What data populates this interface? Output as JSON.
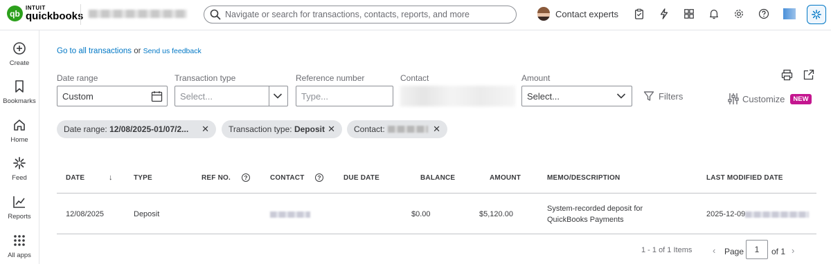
{
  "brand": {
    "intuit": "INTUIT",
    "name": "quickbooks",
    "mark": "qb",
    "color": "#2ca01c"
  },
  "search": {
    "placeholder": "Navigate or search for transactions, contacts, reports, and more"
  },
  "header": {
    "contact_experts": "Contact experts",
    "icons": [
      "clipboard-icon",
      "lightning-icon",
      "apps-grid-icon",
      "bell-icon",
      "gear-icon",
      "help-icon",
      "app-square-icon",
      "sparkle-icon"
    ]
  },
  "sidebar": {
    "items": [
      {
        "label": "Create",
        "icon": "plus-circle-icon"
      },
      {
        "label": "Bookmarks",
        "icon": "bookmark-icon"
      },
      {
        "label": "Home",
        "icon": "home-icon"
      },
      {
        "label": "Feed",
        "icon": "sparkle-icon"
      },
      {
        "label": "Reports",
        "icon": "line-chart-icon"
      },
      {
        "label": "All apps",
        "icon": "dots-grid-icon"
      }
    ]
  },
  "links": {
    "all_transactions": "Go to all transactions",
    "or": "or",
    "feedback": "Send us feedback"
  },
  "filters": {
    "date_range": {
      "label": "Date range",
      "value": "Custom"
    },
    "transaction_type": {
      "label": "Transaction type",
      "placeholder": "Select..."
    },
    "reference_number": {
      "label": "Reference number",
      "placeholder": "Type..."
    },
    "contact": {
      "label": "Contact"
    },
    "amount": {
      "label": "Amount",
      "placeholder": "Select..."
    },
    "filters_button": "Filters",
    "customize": "Customize",
    "new_badge": "NEW"
  },
  "chips": [
    {
      "prefix": "Date range: ",
      "value": "12/08/2025-01/07/2..."
    },
    {
      "prefix": "Transaction type: ",
      "value": "Deposit"
    },
    {
      "prefix": "Contact:",
      "value": ""
    }
  ],
  "table": {
    "headers": {
      "date": "DATE",
      "sort_arrow": "↓",
      "type": "TYPE",
      "ref_no": "REF NO.",
      "contact": "CONTACT",
      "due_date": "DUE DATE",
      "balance": "BALANCE",
      "amount": "AMOUNT",
      "memo": "MEMO/DESCRIPTION",
      "last_modified": "LAST MODIFIED DATE"
    },
    "help_glyph": "?",
    "rows": [
      {
        "date": "12/08/2025",
        "type": "Deposit",
        "ref_no": "",
        "due_date": "",
        "balance": "$0.00",
        "amount": "$5,120.00",
        "memo_line1": "System-recorded deposit for",
        "memo_line2": "QuickBooks Payments",
        "last_modified": "2025-12-09"
      }
    ]
  },
  "pagination": {
    "count": "1 - 1 of 1 Items",
    "page_label": "Page",
    "page": "1",
    "of": "of 1",
    "prev": "‹",
    "next": "›"
  },
  "colors": {
    "link": "#0077c5",
    "badge": "#c4168f",
    "border": "#8d9096"
  }
}
